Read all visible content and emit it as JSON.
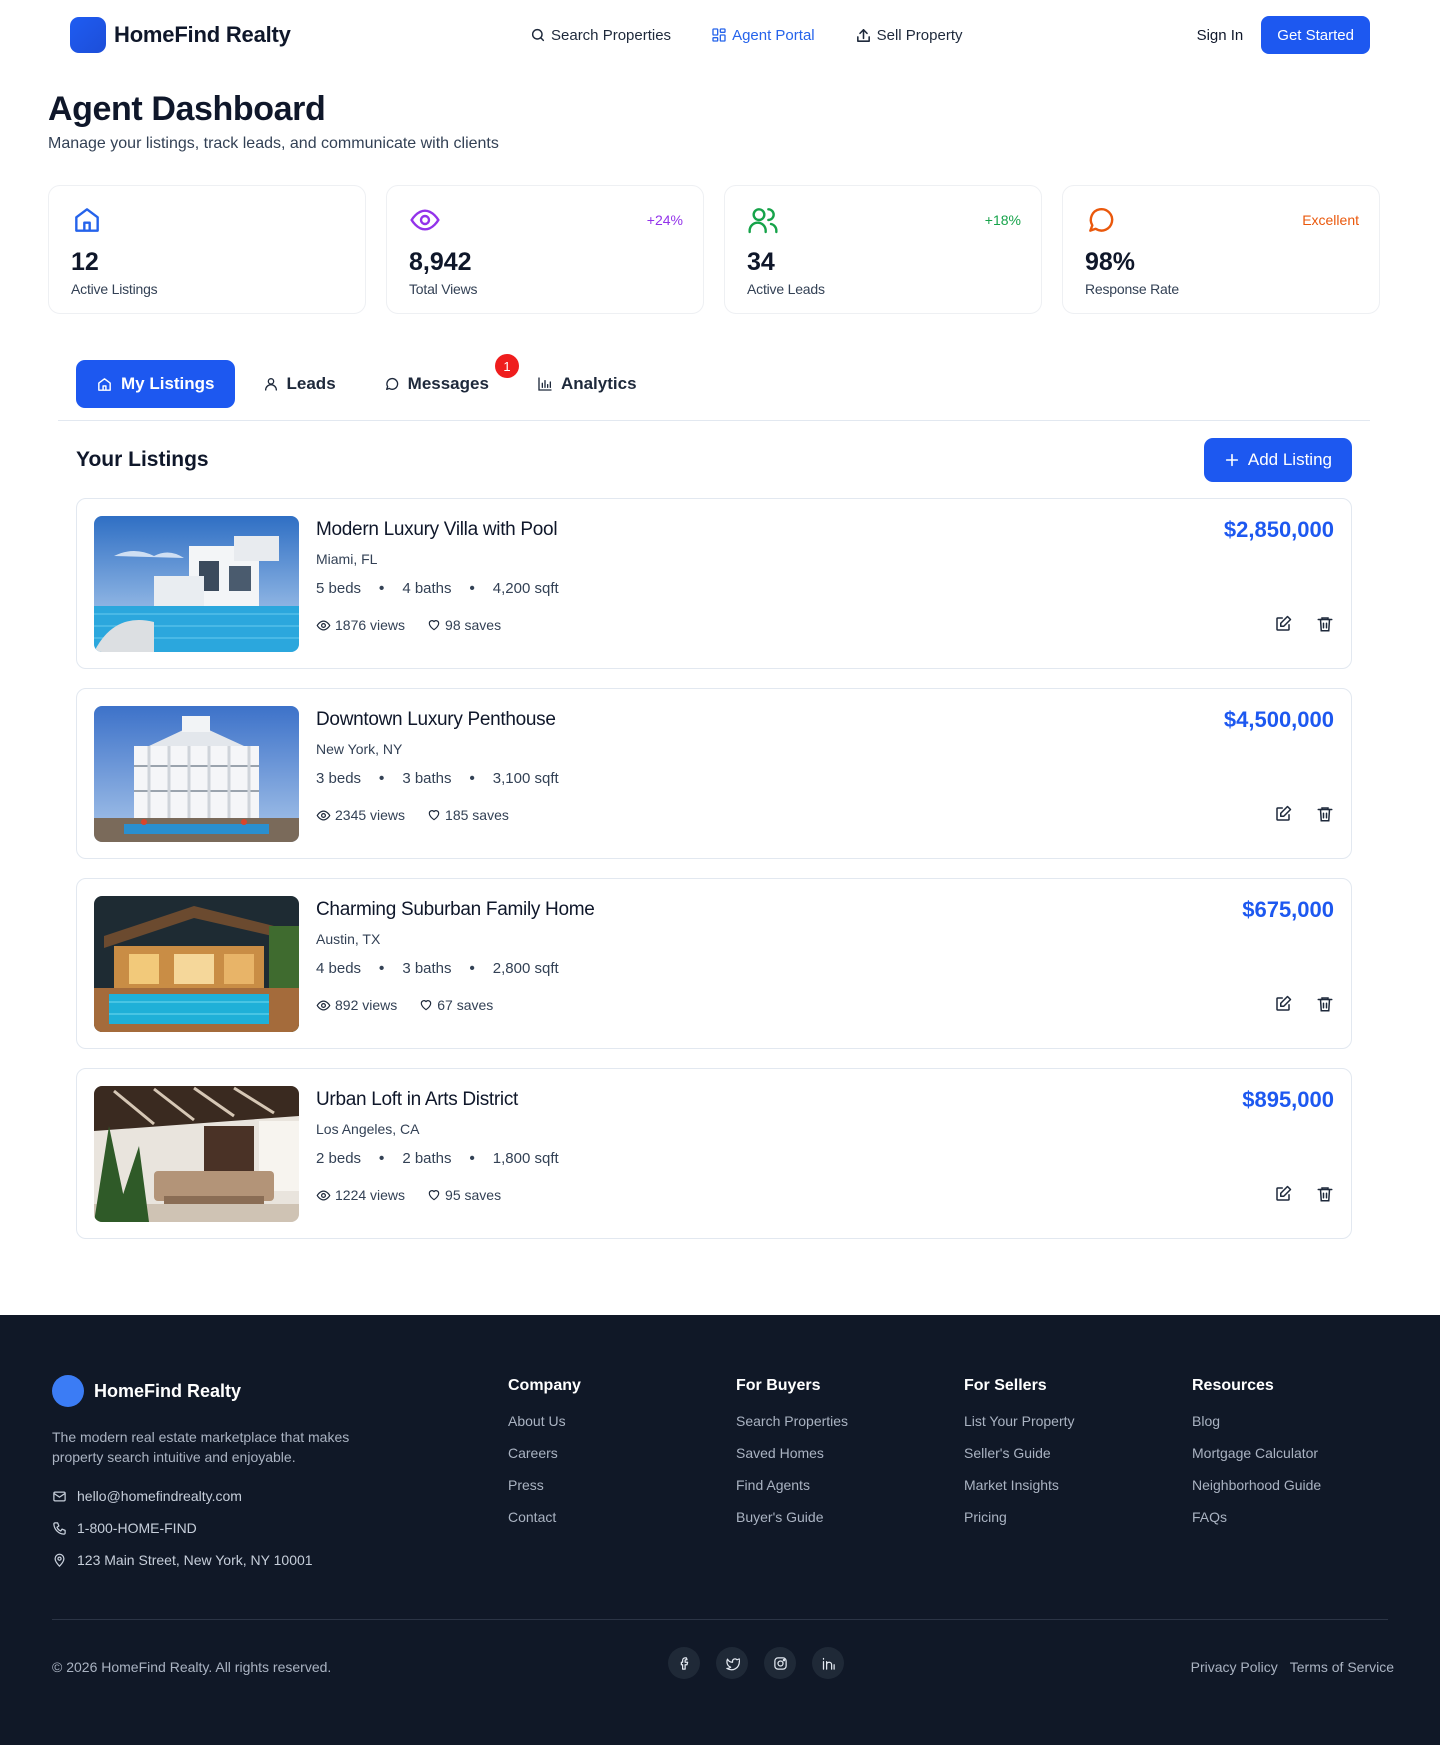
{
  "header": {
    "brand": "HomeFind Realty",
    "nav": [
      {
        "label": "Search Properties",
        "icon": "search-icon",
        "active": false
      },
      {
        "label": "Agent Portal",
        "icon": "grid-icon",
        "active": true
      },
      {
        "label": "Sell Property",
        "icon": "upload-icon",
        "active": false
      }
    ],
    "sign_in": "Sign In",
    "get_started": "Get Started"
  },
  "page": {
    "title": "Agent Dashboard",
    "subtitle": "Manage your listings, track leads, and communicate with clients"
  },
  "stats": [
    {
      "value": "12",
      "label": "Active Listings",
      "trend": "",
      "icon": "home-icon",
      "color": "#2563eb"
    },
    {
      "value": "8,942",
      "label": "Total Views",
      "trend": "+24%",
      "icon": "eye-icon",
      "color": "#9333ea"
    },
    {
      "value": "34",
      "label": "Active Leads",
      "trend": "+18%",
      "icon": "users-icon",
      "color": "#16a34a"
    },
    {
      "value": "98%",
      "label": "Response Rate",
      "trend": "Excellent",
      "icon": "message-icon",
      "color": "#ea580c"
    }
  ],
  "tabs": [
    {
      "label": "My Listings",
      "icon": "home-icon",
      "active": true,
      "badge": ""
    },
    {
      "label": "Leads",
      "icon": "user-icon",
      "active": false,
      "badge": ""
    },
    {
      "label": "Messages",
      "icon": "message-icon",
      "active": false,
      "badge": "1"
    },
    {
      "label": "Analytics",
      "icon": "bar-chart-icon",
      "active": false,
      "badge": ""
    }
  ],
  "listings_section": {
    "title": "Your Listings",
    "add_label": "Add Listing"
  },
  "listings": [
    {
      "title": "Modern Luxury Villa with Pool",
      "location": "Miami, FL",
      "beds": "5 beds",
      "baths": "4 baths",
      "sqft": "4,200 sqft",
      "views": "1876 views",
      "saves": "98 saves",
      "price": "$2,850,000"
    },
    {
      "title": "Downtown Luxury Penthouse",
      "location": "New York, NY",
      "beds": "3 beds",
      "baths": "3 baths",
      "sqft": "3,100 sqft",
      "views": "2345 views",
      "saves": "185 saves",
      "price": "$4,500,000"
    },
    {
      "title": "Charming Suburban Family Home",
      "location": "Austin, TX",
      "beds": "4 beds",
      "baths": "3 baths",
      "sqft": "2,800 sqft",
      "views": "892 views",
      "saves": "67 saves",
      "price": "$675,000"
    },
    {
      "title": "Urban Loft in Arts District",
      "location": "Los Angeles, CA",
      "beds": "2 beds",
      "baths": "2 baths",
      "sqft": "1,800 sqft",
      "views": "1224 views",
      "saves": "95 saves",
      "price": "$895,000"
    }
  ],
  "footer": {
    "brand": "HomeFind Realty",
    "description": "The modern real estate marketplace that makes property search intuitive and enjoyable.",
    "email": "hello@homefindrealty.com",
    "phone": "1-800-HOME-FIND",
    "address": "123 Main Street, New York, NY 10001",
    "columns": [
      {
        "title": "Company",
        "links": [
          "About Us",
          "Careers",
          "Press",
          "Contact"
        ]
      },
      {
        "title": "For Buyers",
        "links": [
          "Search Properties",
          "Saved Homes",
          "Find Agents",
          "Buyer's Guide"
        ]
      },
      {
        "title": "For Sellers",
        "links": [
          "List Your Property",
          "Seller's Guide",
          "Market Insights",
          "Pricing"
        ]
      },
      {
        "title": "Resources",
        "links": [
          "Blog",
          "Mortgage Calculator",
          "Neighborhood Guide",
          "FAQs"
        ]
      }
    ],
    "copyright": "© 2026 HomeFind Realty. All rights reserved.",
    "socials": [
      "facebook-icon",
      "twitter-icon",
      "instagram-icon",
      "linkedin-icon"
    ],
    "legal": [
      "Privacy Policy",
      "Terms of Service"
    ]
  },
  "colors": {
    "primary": "#1d58f0",
    "footer_bg": "#101827",
    "badge": "#ef1d1d"
  }
}
